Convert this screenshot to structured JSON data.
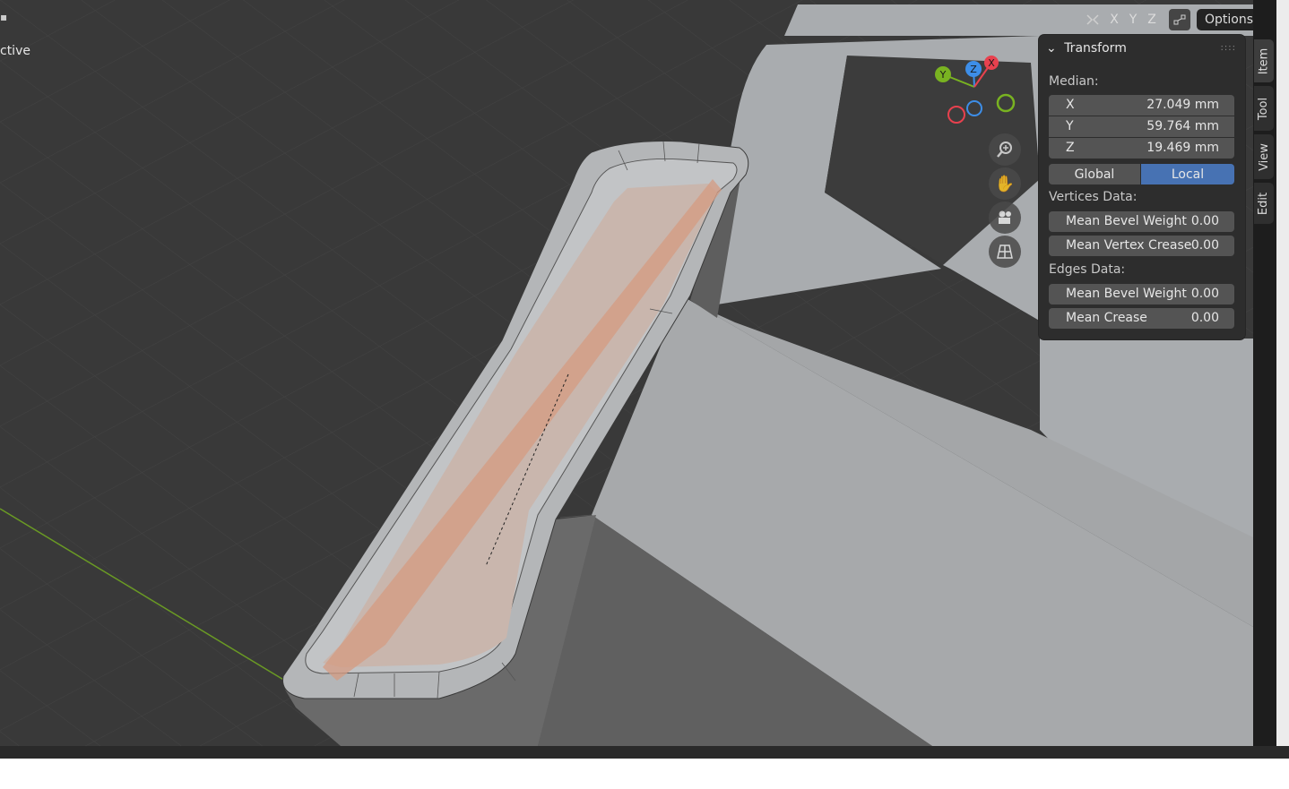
{
  "viewport": {
    "mode_text": "ctive"
  },
  "header": {
    "mirror_icon": "mirror-icon",
    "axes": [
      "X",
      "Y",
      "Z"
    ],
    "snap_icon": "auto-merge-icon",
    "options_label": "Options"
  },
  "gizmo": {
    "x_label": "X",
    "y_label": "Y",
    "z_label": "Z",
    "colors": {
      "x": "#e8414e",
      "y": "#79b321",
      "z": "#3d8ee8"
    }
  },
  "nav_buttons": [
    "zoom-icon",
    "hand-pan-icon",
    "camera-icon",
    "grid-ortho-icon"
  ],
  "transform_panel": {
    "title": "Transform",
    "median_label": "Median:",
    "fields": [
      {
        "axis": "X",
        "value": "27.049 mm"
      },
      {
        "axis": "Y",
        "value": "59.764 mm"
      },
      {
        "axis": "Z",
        "value": "19.469 mm"
      }
    ],
    "space_toggle": {
      "global": "Global",
      "local": "Local",
      "selected": "Local"
    },
    "vertices_label": "Vertices Data:",
    "vertices": [
      {
        "label": "Mean Bevel Weight",
        "value": "0.00"
      },
      {
        "label": "Mean Vertex Crease",
        "value": "0.00"
      }
    ],
    "edges_label": "Edges Data:",
    "edges": [
      {
        "label": "Mean Bevel Weight",
        "value": "0.00"
      },
      {
        "label": "Mean Crease",
        "value": "0.00"
      }
    ]
  },
  "sidebar_tabs": [
    {
      "label": "Item",
      "active": true
    },
    {
      "label": "Tool",
      "active": false
    },
    {
      "label": "View",
      "active": false
    },
    {
      "label": "Edit",
      "active": false
    }
  ],
  "colors": {
    "accent": "#4772b3",
    "viewport_bg": "#393939",
    "panel_bg": "#2d2d2d",
    "field_bg": "#545454",
    "face_select": "#e8a080",
    "x_axis_line": "#6a9a24"
  }
}
